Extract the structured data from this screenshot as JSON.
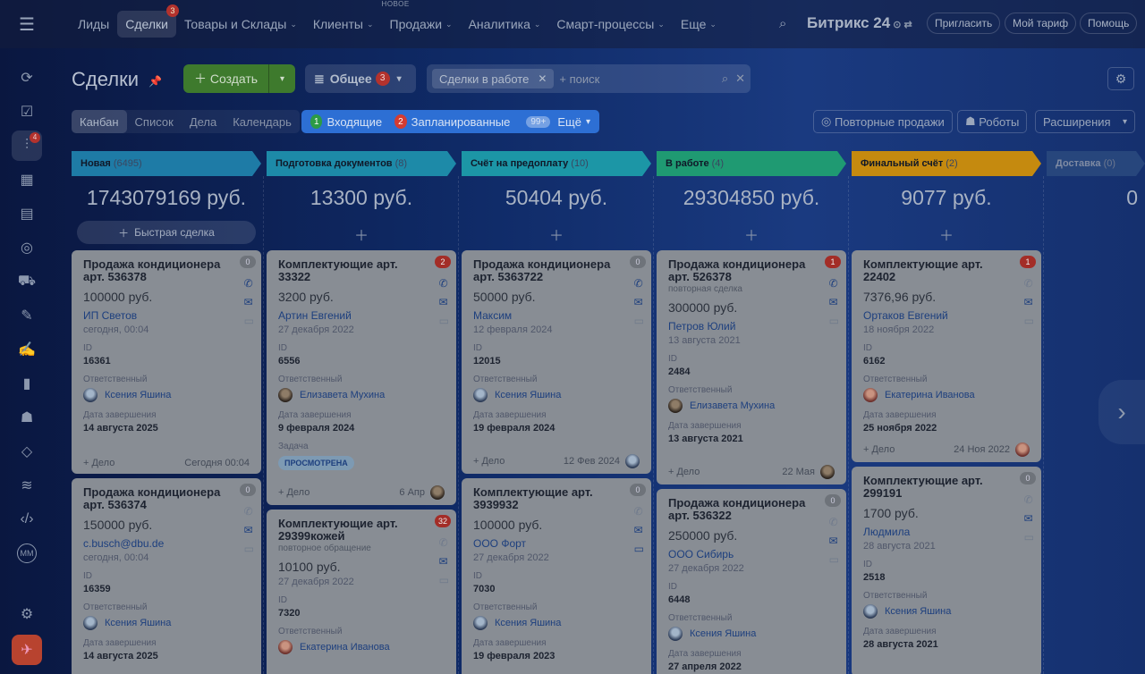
{
  "nav": {
    "items": [
      {
        "label": "Лиды"
      },
      {
        "label": "Сделки",
        "badge": "3"
      },
      {
        "label": "Товары и Склады"
      },
      {
        "label": "Клиенты"
      },
      {
        "label": "Продажи",
        "new": "НОВОЕ"
      },
      {
        "label": "Аналитика"
      },
      {
        "label": "Смарт-процессы"
      },
      {
        "label": "Еще"
      }
    ],
    "brand": "Битрикс 24",
    "invite": "Пригласить",
    "tariff": "Мой тариф",
    "help": "Помощь"
  },
  "sidebar": {
    "deals_badge": "4",
    "avatar": "ММ"
  },
  "header": {
    "title": "Сделки",
    "create": "Создать",
    "filter": "Общее",
    "filter_badge": "3",
    "chip": "Сделки в работе",
    "search_placeholder": "+ поиск"
  },
  "views": [
    "Канбан",
    "Список",
    "Дела",
    "Календарь"
  ],
  "counters": {
    "c1": "1",
    "l1": "Входящие",
    "c2": "2",
    "l2": "Запланированные",
    "c3": "99+",
    "more": "Ещё"
  },
  "right": {
    "repeat": "Повторные продажи",
    "robots": "Роботы",
    "ext": "Расширения"
  },
  "quick": "Быстрая сделка",
  "labels": {
    "id": "ID",
    "resp": "Ответственный",
    "close": "Дата завершения",
    "task": "Задача",
    "add": "+ Дело"
  },
  "columns": [
    {
      "name": "Новая",
      "count": "(6495)",
      "sum": "1743079169 руб.",
      "color": "#1e7ba6",
      "cards": [
        {
          "title": "Продажа кондиционера арт. 536378",
          "badge": "0",
          "price": "100000 руб.",
          "client": "ИП Светов",
          "date": "сегодня, 00:04",
          "id": "16361",
          "resp": "Ксения Яшина",
          "close": "14 августа 2025",
          "foot": "Сегодня 00:04"
        },
        {
          "title": "Продажа кондиционера арт. 536374",
          "badge": "0",
          "price": "150000 руб.",
          "client": "c.busch@dbu.de",
          "date": "сегодня, 00:04",
          "id": "16359",
          "resp": "Ксения Яшина",
          "close": "14 августа 2025"
        }
      ]
    },
    {
      "name": "Подготовка документов",
      "count": "(8)",
      "sum": "13300 руб.",
      "color": "#1d8aa8",
      "cards": [
        {
          "title": "Комплектующие арт. 33322",
          "badge": "2",
          "price": "3200 руб.",
          "client": "Артин Евгений",
          "date": "27 декабря 2022",
          "id": "6556",
          "resp": "Елизавета Мухина",
          "close": "9 февраля 2024",
          "tag": "ПРОСМОТРЕНА",
          "foot": "6 Апр"
        },
        {
          "title": "Комплектующие арт. 29399кожей",
          "badge": "32",
          "sub": "повторное обращение",
          "price": "10100 руб.",
          "date": "27 декабря 2022",
          "id": "7320",
          "resp": "Екатерина Иванова"
        }
      ]
    },
    {
      "name": "Счёт на предоплату",
      "count": "(10)",
      "sum": "50404 руб.",
      "color": "#1c96a6",
      "cards": [
        {
          "title": "Продажа кондиционера арт. 5363722",
          "badge": "0",
          "price": "50000 руб.",
          "client": "Максим",
          "date": "12 февраля 2024",
          "id": "12015",
          "resp": "Ксения Яшина",
          "close": "19 февраля 2024",
          "foot": "12 Фев 2024"
        },
        {
          "title": "Комплектующие арт. 3939932",
          "badge": "0",
          "price": "100000 руб.",
          "client": "ООО Форт",
          "date": "27 декабря 2022",
          "id": "7030",
          "resp": "Ксения Яшина",
          "close": "19 февраля 2023"
        }
      ]
    },
    {
      "name": "В работе",
      "count": "(4)",
      "sum": "29304850 руб.",
      "color": "#1f9a72",
      "cards": [
        {
          "title": "Продажа кондиционера арт. 526378",
          "badge": "1",
          "sub": "повторная сделка",
          "price": "300000 руб.",
          "client": "Петров Юлий",
          "date": "13 августа 2021",
          "id": "2484",
          "resp": "Елизавета Мухина",
          "close": "13 августа 2021",
          "foot": "22 Мая"
        },
        {
          "title": "Продажа кондиционера арт. 536322",
          "badge": "0",
          "price": "250000 руб.",
          "client": "ООО Сибирь",
          "date": "27 декабря 2022",
          "id": "6448",
          "resp": "Ксения Яшина",
          "close": "27 апреля 2022"
        }
      ]
    },
    {
      "name": "Финальный счёт",
      "count": "(2)",
      "sum": "9077 руб.",
      "color": "#c58a0f",
      "cards": [
        {
          "title": "Комплектующие арт. 22402",
          "badge": "1",
          "price": "7376,96 руб.",
          "client": "Ортаков Евгений",
          "date": "18 ноября 2022",
          "id": "6162",
          "resp": "Екатерина Иванова",
          "close": "25 ноября 2022",
          "foot": "24 Ноя 2022"
        },
        {
          "title": "Комплектующие арт. 299191",
          "badge": "0",
          "price": "1700 руб.",
          "client": "Людмила",
          "date": "28 августа 2021",
          "id": "2518",
          "resp": "Ксения Яшина",
          "close": "28 августа 2021"
        }
      ]
    },
    {
      "name": "Доставка",
      "count": "(0)",
      "sum": "0",
      "color": "#27467c",
      "cards": []
    }
  ]
}
